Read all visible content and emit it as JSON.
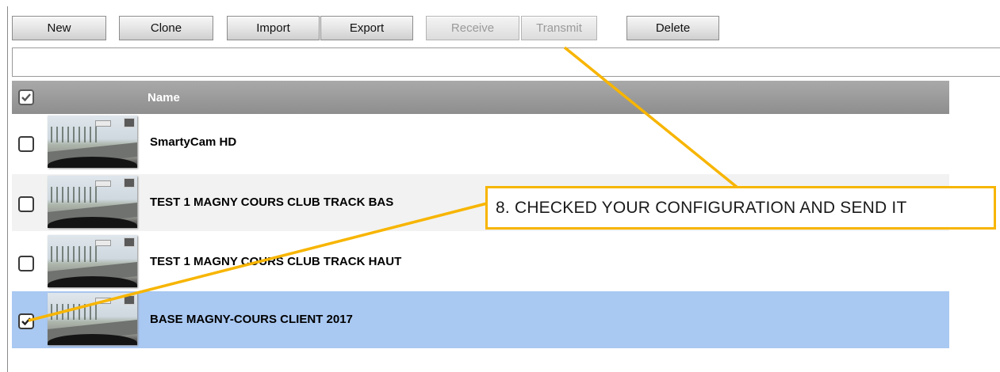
{
  "toolbar": {
    "new_label": "New",
    "clone_label": "Clone",
    "import_label": "Import",
    "export_label": "Export",
    "receive_label": "Receive",
    "transmit_label": "Transmit",
    "delete_label": "Delete"
  },
  "search": {
    "value": ""
  },
  "table": {
    "header": {
      "name": "Name",
      "select_all_checked": true
    },
    "rows": [
      {
        "name": "SmartyCam HD",
        "checked": false,
        "selected": false
      },
      {
        "name": "TEST 1 MAGNY COURS CLUB TRACK BAS",
        "checked": false,
        "selected": false
      },
      {
        "name": "TEST 1 MAGNY COURS CLUB TRACK HAUT",
        "checked": false,
        "selected": false
      },
      {
        "name": "BASE MAGNY-COURS CLIENT 2017",
        "checked": true,
        "selected": true
      }
    ]
  },
  "callout": {
    "text": "8. CHECKED YOUR CONFIGURATION AND SEND IT",
    "color": "#f7b500"
  },
  "colors": {
    "header_bg": "#999999",
    "selected_row_bg": "#a9c8f2",
    "alt_row_bg": "#f2f2f2"
  }
}
